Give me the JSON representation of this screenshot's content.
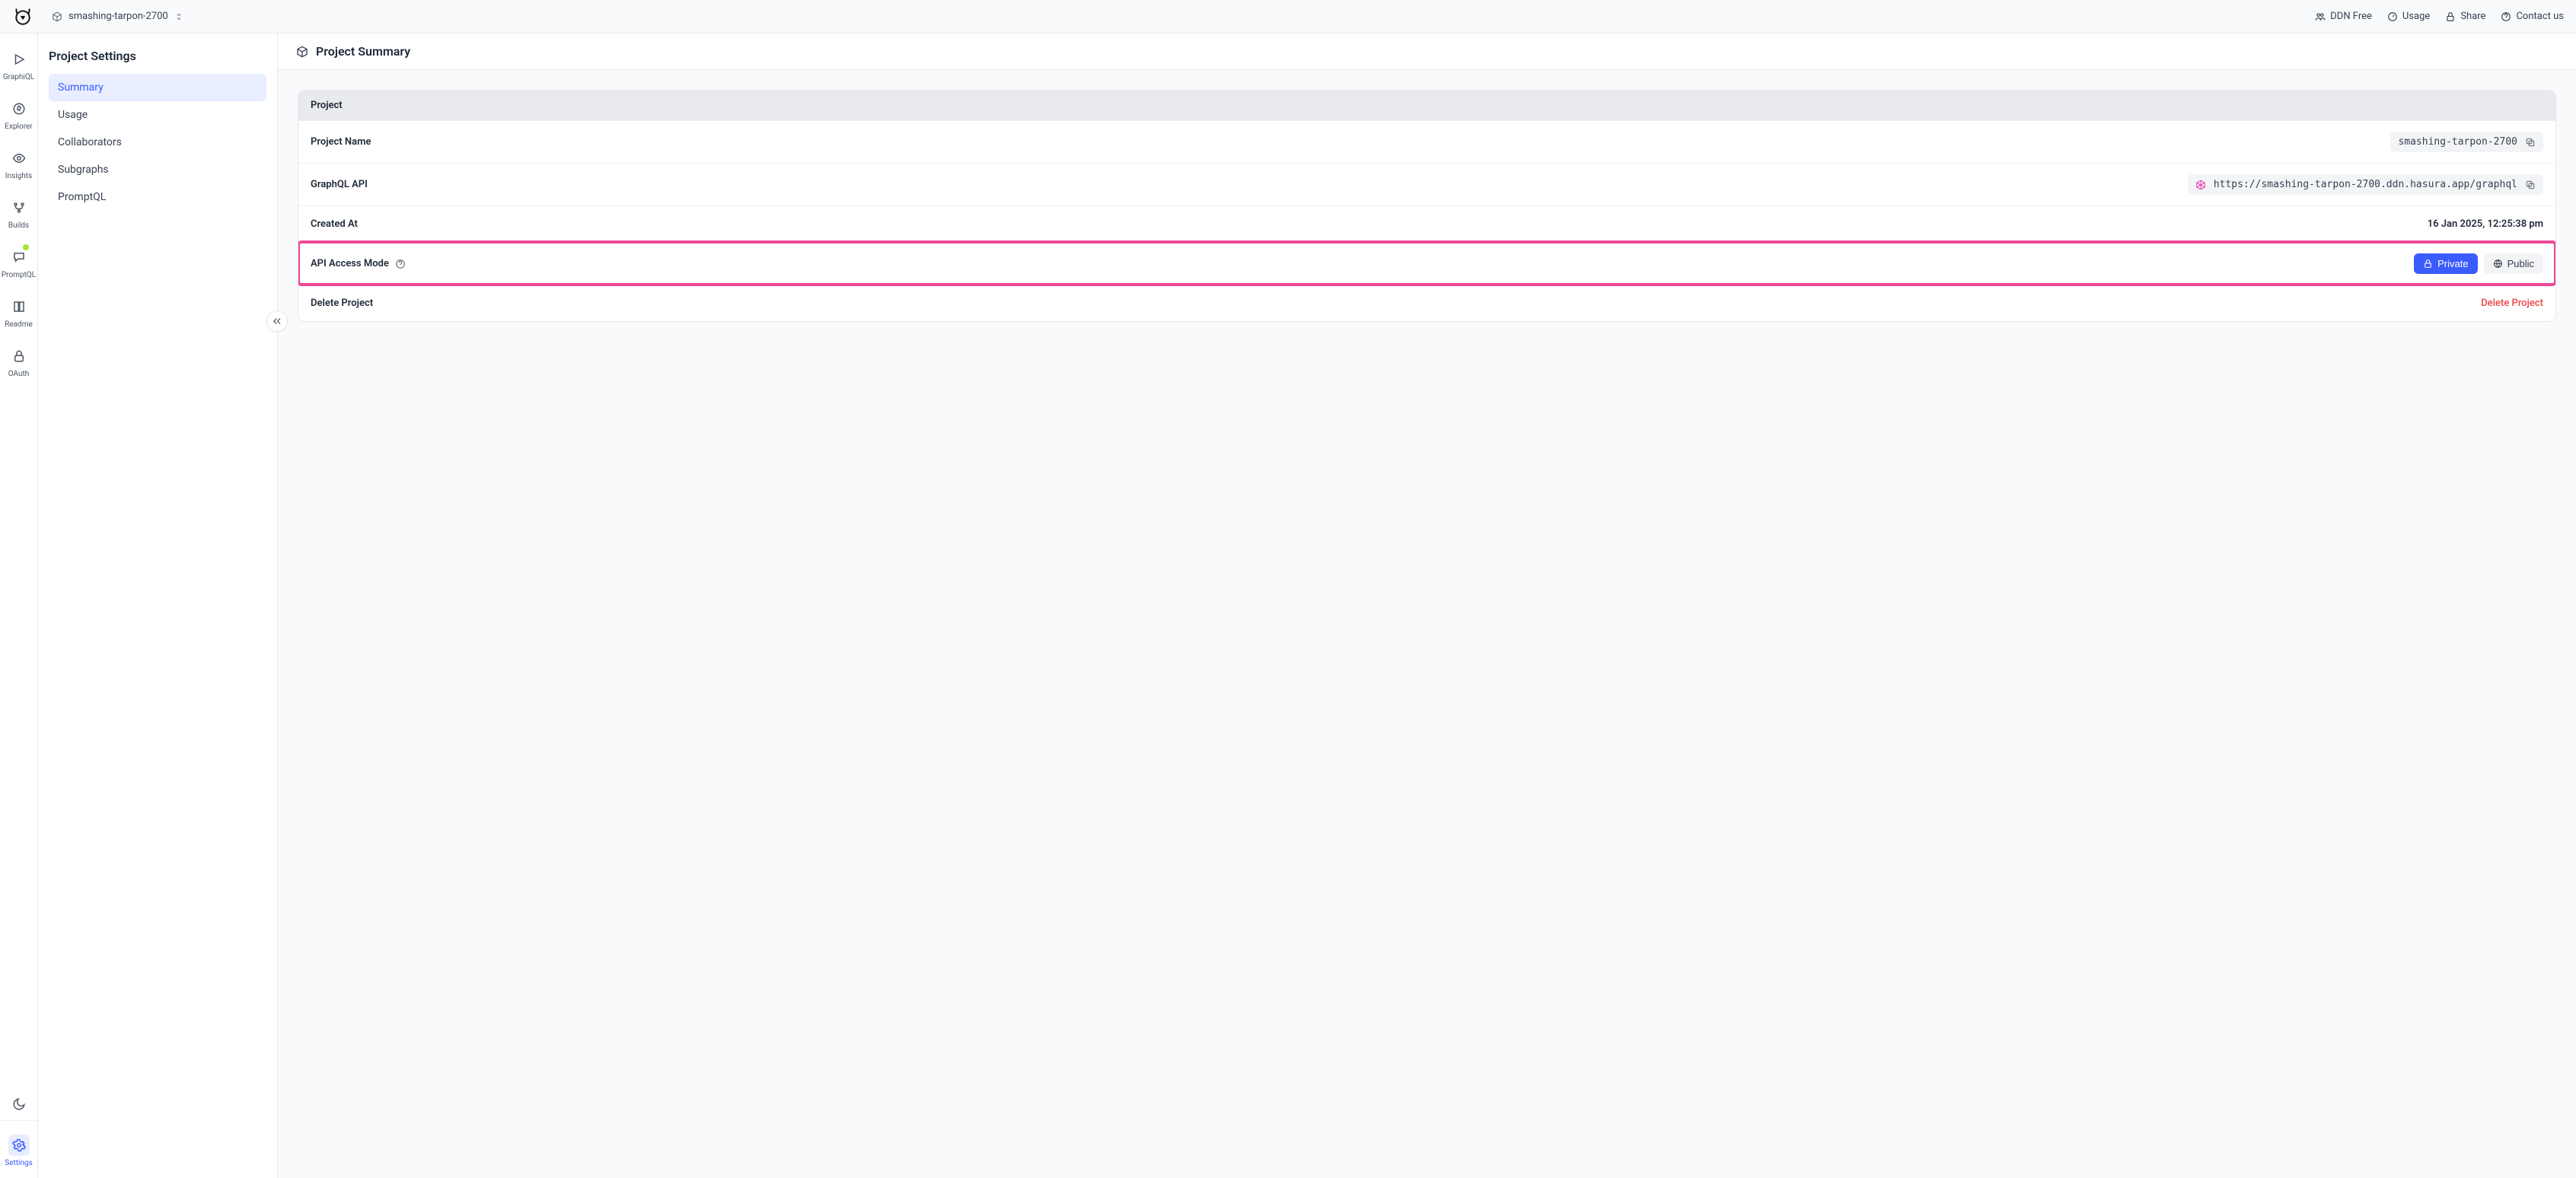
{
  "topbar": {
    "project_name": "smashing-tarpon-2700",
    "links": {
      "ddn_free": "DDN Free",
      "usage": "Usage",
      "share": "Share",
      "contact": "Contact us"
    }
  },
  "rail": {
    "graphiql": "GraphiQL",
    "explorer": "Explorer",
    "insights": "Insights",
    "builds": "Builds",
    "promptql": "PromptQL",
    "readme": "Readme",
    "oauth": "OAuth",
    "settings": "Settings"
  },
  "sidebar": {
    "title": "Project Settings",
    "items": [
      {
        "label": "Summary",
        "active": true
      },
      {
        "label": "Usage",
        "active": false
      },
      {
        "label": "Collaborators",
        "active": false
      },
      {
        "label": "Subgraphs",
        "active": false
      },
      {
        "label": "PromptQL",
        "active": false
      }
    ]
  },
  "main": {
    "title": "Project Summary",
    "card_header": "Project",
    "project_name_label": "Project Name",
    "project_name_value": "smashing-tarpon-2700",
    "graphql_label": "GraphQL API",
    "graphql_url": "https://smashing-tarpon-2700.ddn.hasura.app/graphql",
    "created_label": "Created At",
    "created_value": "16 Jan 2025, 12:25:38 pm",
    "access_label": "API Access Mode",
    "private_label": "Private",
    "public_label": "Public",
    "delete_label": "Delete Project",
    "delete_action": "Delete Project"
  }
}
